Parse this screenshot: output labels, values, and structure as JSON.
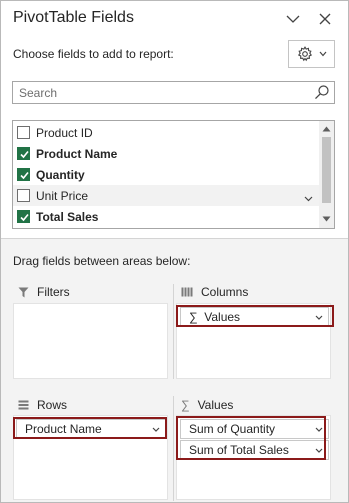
{
  "header": {
    "title": "PivotTable Fields",
    "choose_label": "Choose fields to add to report:"
  },
  "search": {
    "placeholder": "Search",
    "value": ""
  },
  "fields": [
    {
      "label": "Product ID",
      "checked": false,
      "bold": false
    },
    {
      "label": "Product Name",
      "checked": true,
      "bold": true
    },
    {
      "label": "Quantity",
      "checked": true,
      "bold": true
    },
    {
      "label": "Unit Price",
      "checked": false,
      "bold": false
    },
    {
      "label": "Total Sales",
      "checked": true,
      "bold": true
    }
  ],
  "areas": {
    "drag_label": "Drag fields between areas below:",
    "filters": {
      "label": "Filters"
    },
    "columns": {
      "label": "Columns",
      "items": [
        "Values"
      ]
    },
    "rows": {
      "label": "Rows",
      "items": [
        "Product Name"
      ]
    },
    "values": {
      "label": "Values",
      "items": [
        "Sum of Quantity",
        "Sum of Total Sales"
      ]
    }
  },
  "colors": {
    "checkbox_checked": "#217346",
    "highlight_outline": "#8b1a1a",
    "areas_background": "#f3f3f3"
  },
  "icons": {
    "dropdown": "chevron-down-icon",
    "close": "close-icon",
    "settings": "gear-icon",
    "search": "search-icon",
    "filter": "filter-icon",
    "columns": "columns-icon",
    "rows": "rows-icon",
    "values": "sigma-icon"
  }
}
